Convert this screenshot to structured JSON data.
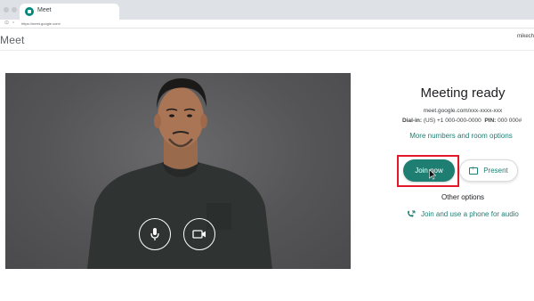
{
  "browser": {
    "tab_title": "Meet",
    "url": "https://meet.google.com/"
  },
  "header": {
    "brand": "Meet",
    "user": "mikech"
  },
  "preview": {
    "mic_icon": "microphone-icon",
    "camera_icon": "video-camera-icon"
  },
  "panel": {
    "title": "Meeting ready",
    "meeting_link": "meet.google.com/xxx-xxxx-xxx",
    "dial_in_label": "Dial-in:",
    "dial_in_number": "(US) +1 000-000-0000",
    "pin_label": "PIN:",
    "pin_value": "000 000#",
    "more_numbers": "More numbers and room options",
    "join_label": "Join now",
    "present_label": "Present",
    "other_options": "Other options",
    "phone_audio": "Join and use a phone for audio"
  },
  "colors": {
    "accent": "#1e7e72",
    "highlight": "#e4182a",
    "video_bg": "#5a5a5c"
  }
}
